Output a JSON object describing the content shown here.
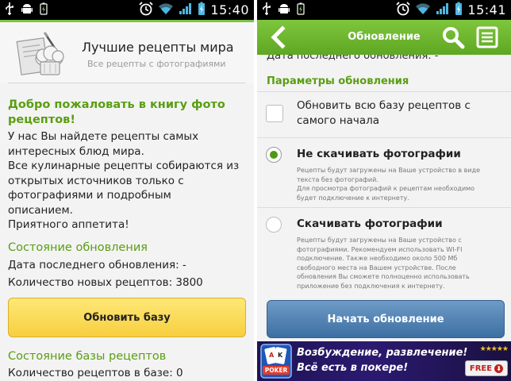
{
  "left": {
    "status": {
      "time": "15:40"
    },
    "header": {
      "title": "Лучшие рецепты мира",
      "subtitle": "Все рецепты с фотографиями"
    },
    "welcome": {
      "title_line1": "Добро пожаловать в книгу фото",
      "title_line2": "рецептов!",
      "lines": [
        "У нас Вы найдете рецепты самых",
        "интересных блюд мира.",
        "Все кулинарные рецепты собираются из",
        "открытых источников только с",
        "фотографиями и подробным",
        "описанием.",
        "Приятного аппетита!"
      ]
    },
    "update_status": {
      "title": "Состояние обновления",
      "last_update": "Дата последнего обновления: -",
      "new_count": "Количество новых рецептов: 3800"
    },
    "update_button": "Обновить базу",
    "db_status": {
      "title": "Состояние базы рецептов",
      "count": "Количество рецептов в базе: 0"
    }
  },
  "right": {
    "status": {
      "time": "15:41"
    },
    "actionbar": {
      "title": "Обновление"
    },
    "cut_text": "Дата последнего обновления: -",
    "section_title": "Параметры обновления",
    "option_full": {
      "label_line1": "Обновить всю базу рецептов с",
      "label_line2": "самого начала",
      "checked": false
    },
    "option_no_photos": {
      "label": "Не скачивать фотографии",
      "selected": true,
      "desc": [
        "Рецепты будут загружены на Ваше устройство в виде",
        "текста без фотографий.",
        "Для просмотра фотографий к рецептам необходимо",
        "будет подключение к интернету."
      ]
    },
    "option_photos": {
      "label": "Скачивать фотографии",
      "selected": false,
      "desc": [
        "Рецепты будут загружены на Ваше устройство с",
        "фотографиями. Рекомендуем использовать WI-FI",
        "подключение. Также необходимо около 500 Мб",
        "свободного места на Вашем устройстве. После",
        "обновления Вы сможете полноценно использовать",
        "приложение без подключения к интернету."
      ]
    },
    "start_button": "Начать обновление",
    "ad": {
      "line1": "Возбуждение, развлечение!",
      "line2": "Всё есть в покере!",
      "logo_text": "POKER",
      "badge": "FREE"
    }
  },
  "colors": {
    "green": "#5a9e12",
    "actionbar": "#6db82f",
    "yellow_button": "#f8cf3e",
    "blue_button": "#3d6fa3"
  }
}
